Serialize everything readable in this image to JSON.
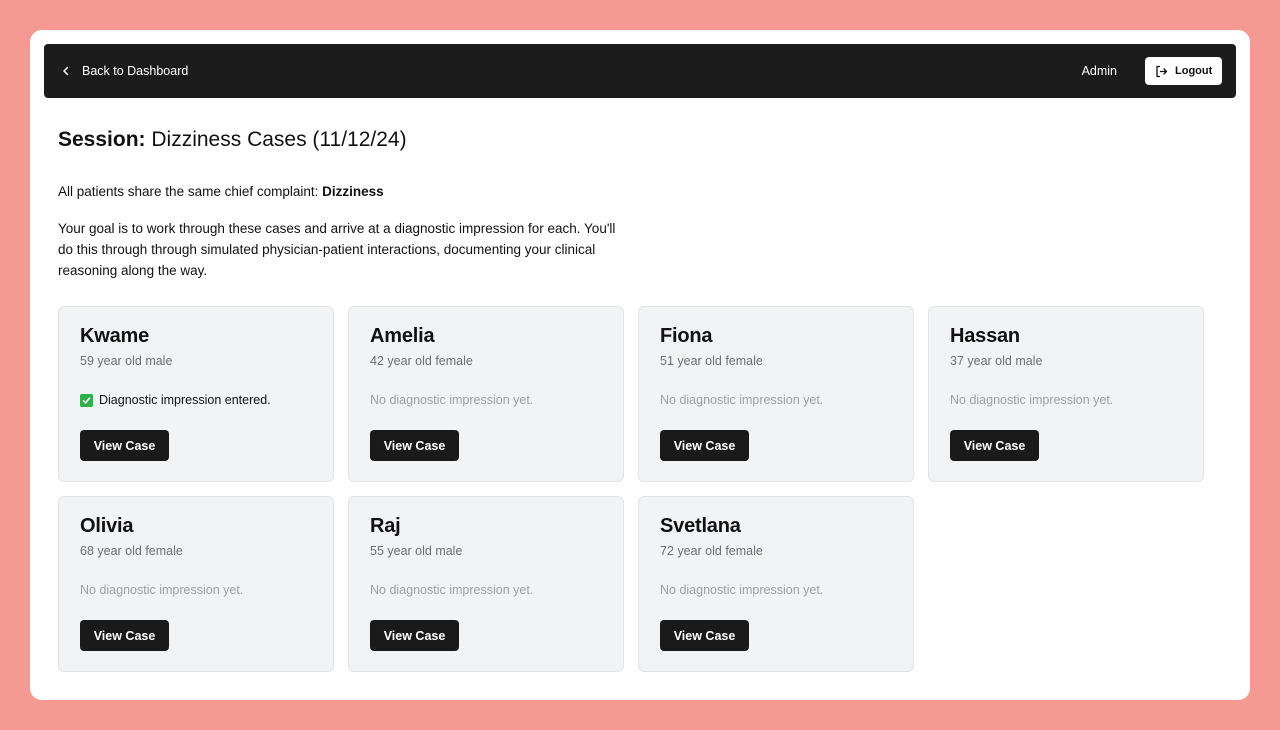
{
  "header": {
    "back_label": "Back to Dashboard",
    "user_label": "Admin",
    "logout_label": "Logout"
  },
  "session": {
    "title_prefix": "Session:",
    "title_name": "Dizziness Cases (11/12/24)",
    "complaint_prefix": "All patients share the same chief complaint:",
    "complaint_value": "Dizziness",
    "goal_text": "Your goal is to work through these cases and arrive at a diagnostic impression for each. You'll do this through through simulated physician-patient interactions, documenting your clinical reasoning along the way."
  },
  "cases": [
    {
      "name": "Kwame",
      "demo": "59 year old male",
      "status": "Diagnostic impression entered.",
      "done": true,
      "button": "View Case"
    },
    {
      "name": "Amelia",
      "demo": "42 year old female",
      "status": "No diagnostic impression yet.",
      "done": false,
      "button": "View Case"
    },
    {
      "name": "Fiona",
      "demo": "51 year old female",
      "status": "No diagnostic impression yet.",
      "done": false,
      "button": "View Case"
    },
    {
      "name": "Hassan",
      "demo": "37 year old male",
      "status": "No diagnostic impression yet.",
      "done": false,
      "button": "View Case"
    },
    {
      "name": "Olivia",
      "demo": "68 year old female",
      "status": "No diagnostic impression yet.",
      "done": false,
      "button": "View Case"
    },
    {
      "name": "Raj",
      "demo": "55 year old male",
      "status": "No diagnostic impression yet.",
      "done": false,
      "button": "View Case"
    },
    {
      "name": "Svetlana",
      "demo": "72 year old female",
      "status": "No diagnostic impression yet.",
      "done": false,
      "button": "View Case"
    }
  ],
  "colors": {
    "background": "#f59a93",
    "topbar": "#1c1c1c",
    "card": "#f2f3f5",
    "check": "#2fae4a"
  },
  "icons": {
    "back": "chevron-left-icon",
    "logout": "logout-icon",
    "status_done": "checkbox-checked-icon"
  }
}
